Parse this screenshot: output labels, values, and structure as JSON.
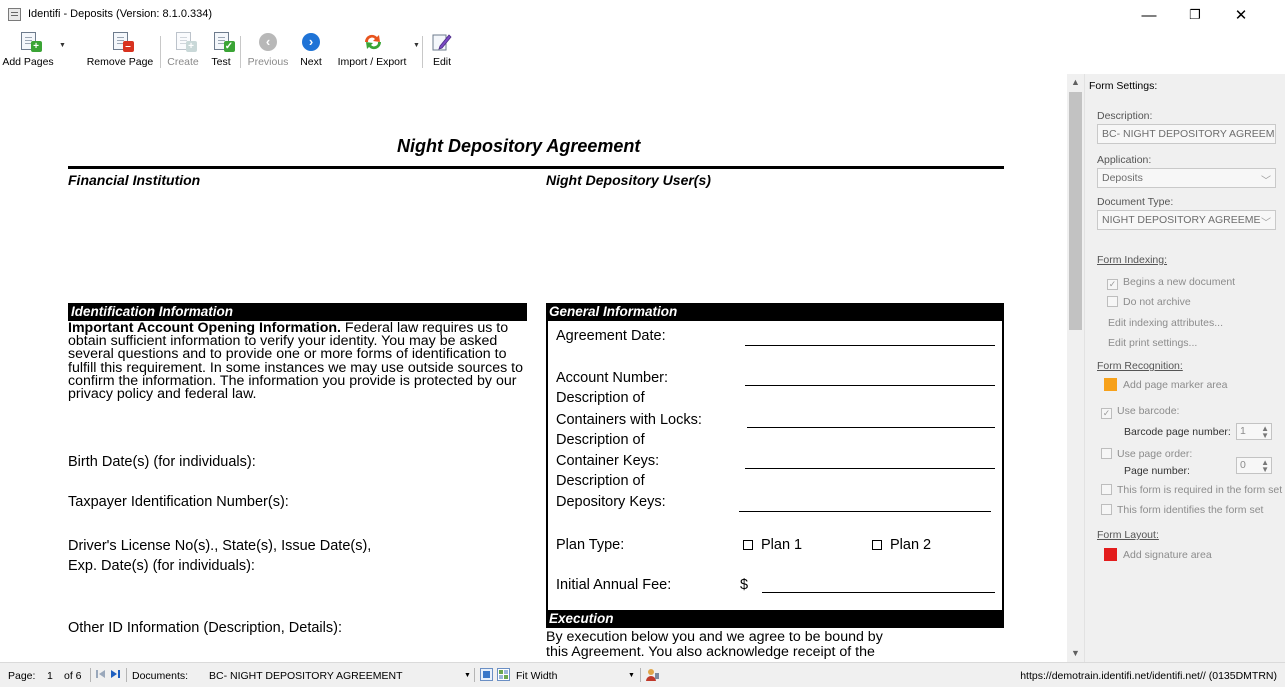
{
  "window": {
    "title": "Identifi - Deposits (Version: 8.1.0.334)",
    "controls": {
      "minimize": "—",
      "restore": "❐",
      "close": "✕"
    }
  },
  "toolbar": {
    "add_pages": "Add Pages",
    "remove_page": "Remove Page",
    "create": "Create",
    "test": "Test",
    "previous": "Previous",
    "next": "Next",
    "import_export": "Import / Export",
    "edit": "Edit"
  },
  "document": {
    "title": "Night Depository  Agreement",
    "left_header": "Financial  Institution",
    "right_header": "Night  Depository  User(s)",
    "identification": {
      "heading": "Identification  Information",
      "para_bold": "Important  Account  Opening  Information.",
      "para_rest": "  Federal law requires us to obtain sufficient  information  to verify your identity.  You may be asked several questions  and to provide one or more forms of identification  to fulfill this requirement.  In some instances  we may use outside sources to confirm the information.  The information  you provide is protected by our privacy policy and federal law.",
      "birth": "Birth Date(s)  (for individuals):",
      "taxpayer": "Taxpayer Identification  Number(s):",
      "drivers_1": "Driver's License No(s).,  State(s),  Issue Date(s),",
      "drivers_2": "Exp. Date(s)  (for individuals):",
      "other": "Other ID Information  (Description,  Details):"
    },
    "general": {
      "heading": "General Information",
      "agreement_date": "Agreement Date:",
      "account_number": "Account Number:",
      "desc_of_1": "Description  of",
      "containers_locks": "Containers with Locks:",
      "desc_of_2": "Description  of",
      "container_keys": "Container Keys:",
      "desc_of_3": "Description  of",
      "depository_keys": "Depository  Keys:",
      "plan_type": "Plan Type:",
      "plan_1": "Plan 1",
      "plan_2": "Plan 2",
      "initial_fee": "Initial  Annual Fee:",
      "dollar": "$"
    },
    "execution": {
      "heading": "Execution",
      "text_1": "By execution  below you and we agree to be bound by",
      "text_2": "this Agreement.  You also acknowledge  receipt of the"
    }
  },
  "panel": {
    "title": "Form Settings:",
    "description_label": "Description:",
    "description_value": "BC- NIGHT DEPOSITORY AGREEME",
    "application_label": "Application:",
    "application_value": "Deposits",
    "doc_type_label": "Document Type:",
    "doc_type_value": "NIGHT DEPOSITORY AGREEME",
    "form_indexing": "Form Indexing:",
    "begins_new": "Begins a new document",
    "do_not_archive": "Do not archive",
    "edit_indexing": "Edit indexing attributes...",
    "edit_print": "Edit print settings...",
    "form_recognition": "Form Recognition:",
    "add_marker": "Add page marker area",
    "use_barcode": "Use barcode:",
    "barcode_page_number": "Barcode page number:",
    "barcode_page_value": "1",
    "use_page_order": "Use page order:",
    "page_number": "Page number:",
    "page_number_value": "0",
    "required_in_set": "This form is required in the form set",
    "identifies_set": "This form identifies the form set",
    "form_layout": "Form Layout:",
    "add_signature": "Add signature area",
    "colors": {
      "marker": "#f7a11a",
      "signature": "#e31c1c"
    }
  },
  "status": {
    "page_label": "Page:",
    "page_num": "1",
    "of_pages": "of 6",
    "documents_label": "Documents:",
    "documents_value": "BC- NIGHT DEPOSITORY AGREEMENT",
    "zoom": "Fit Width",
    "url": "https://demotrain.identifi.net/identifi.net// (0135DMTRN)"
  }
}
